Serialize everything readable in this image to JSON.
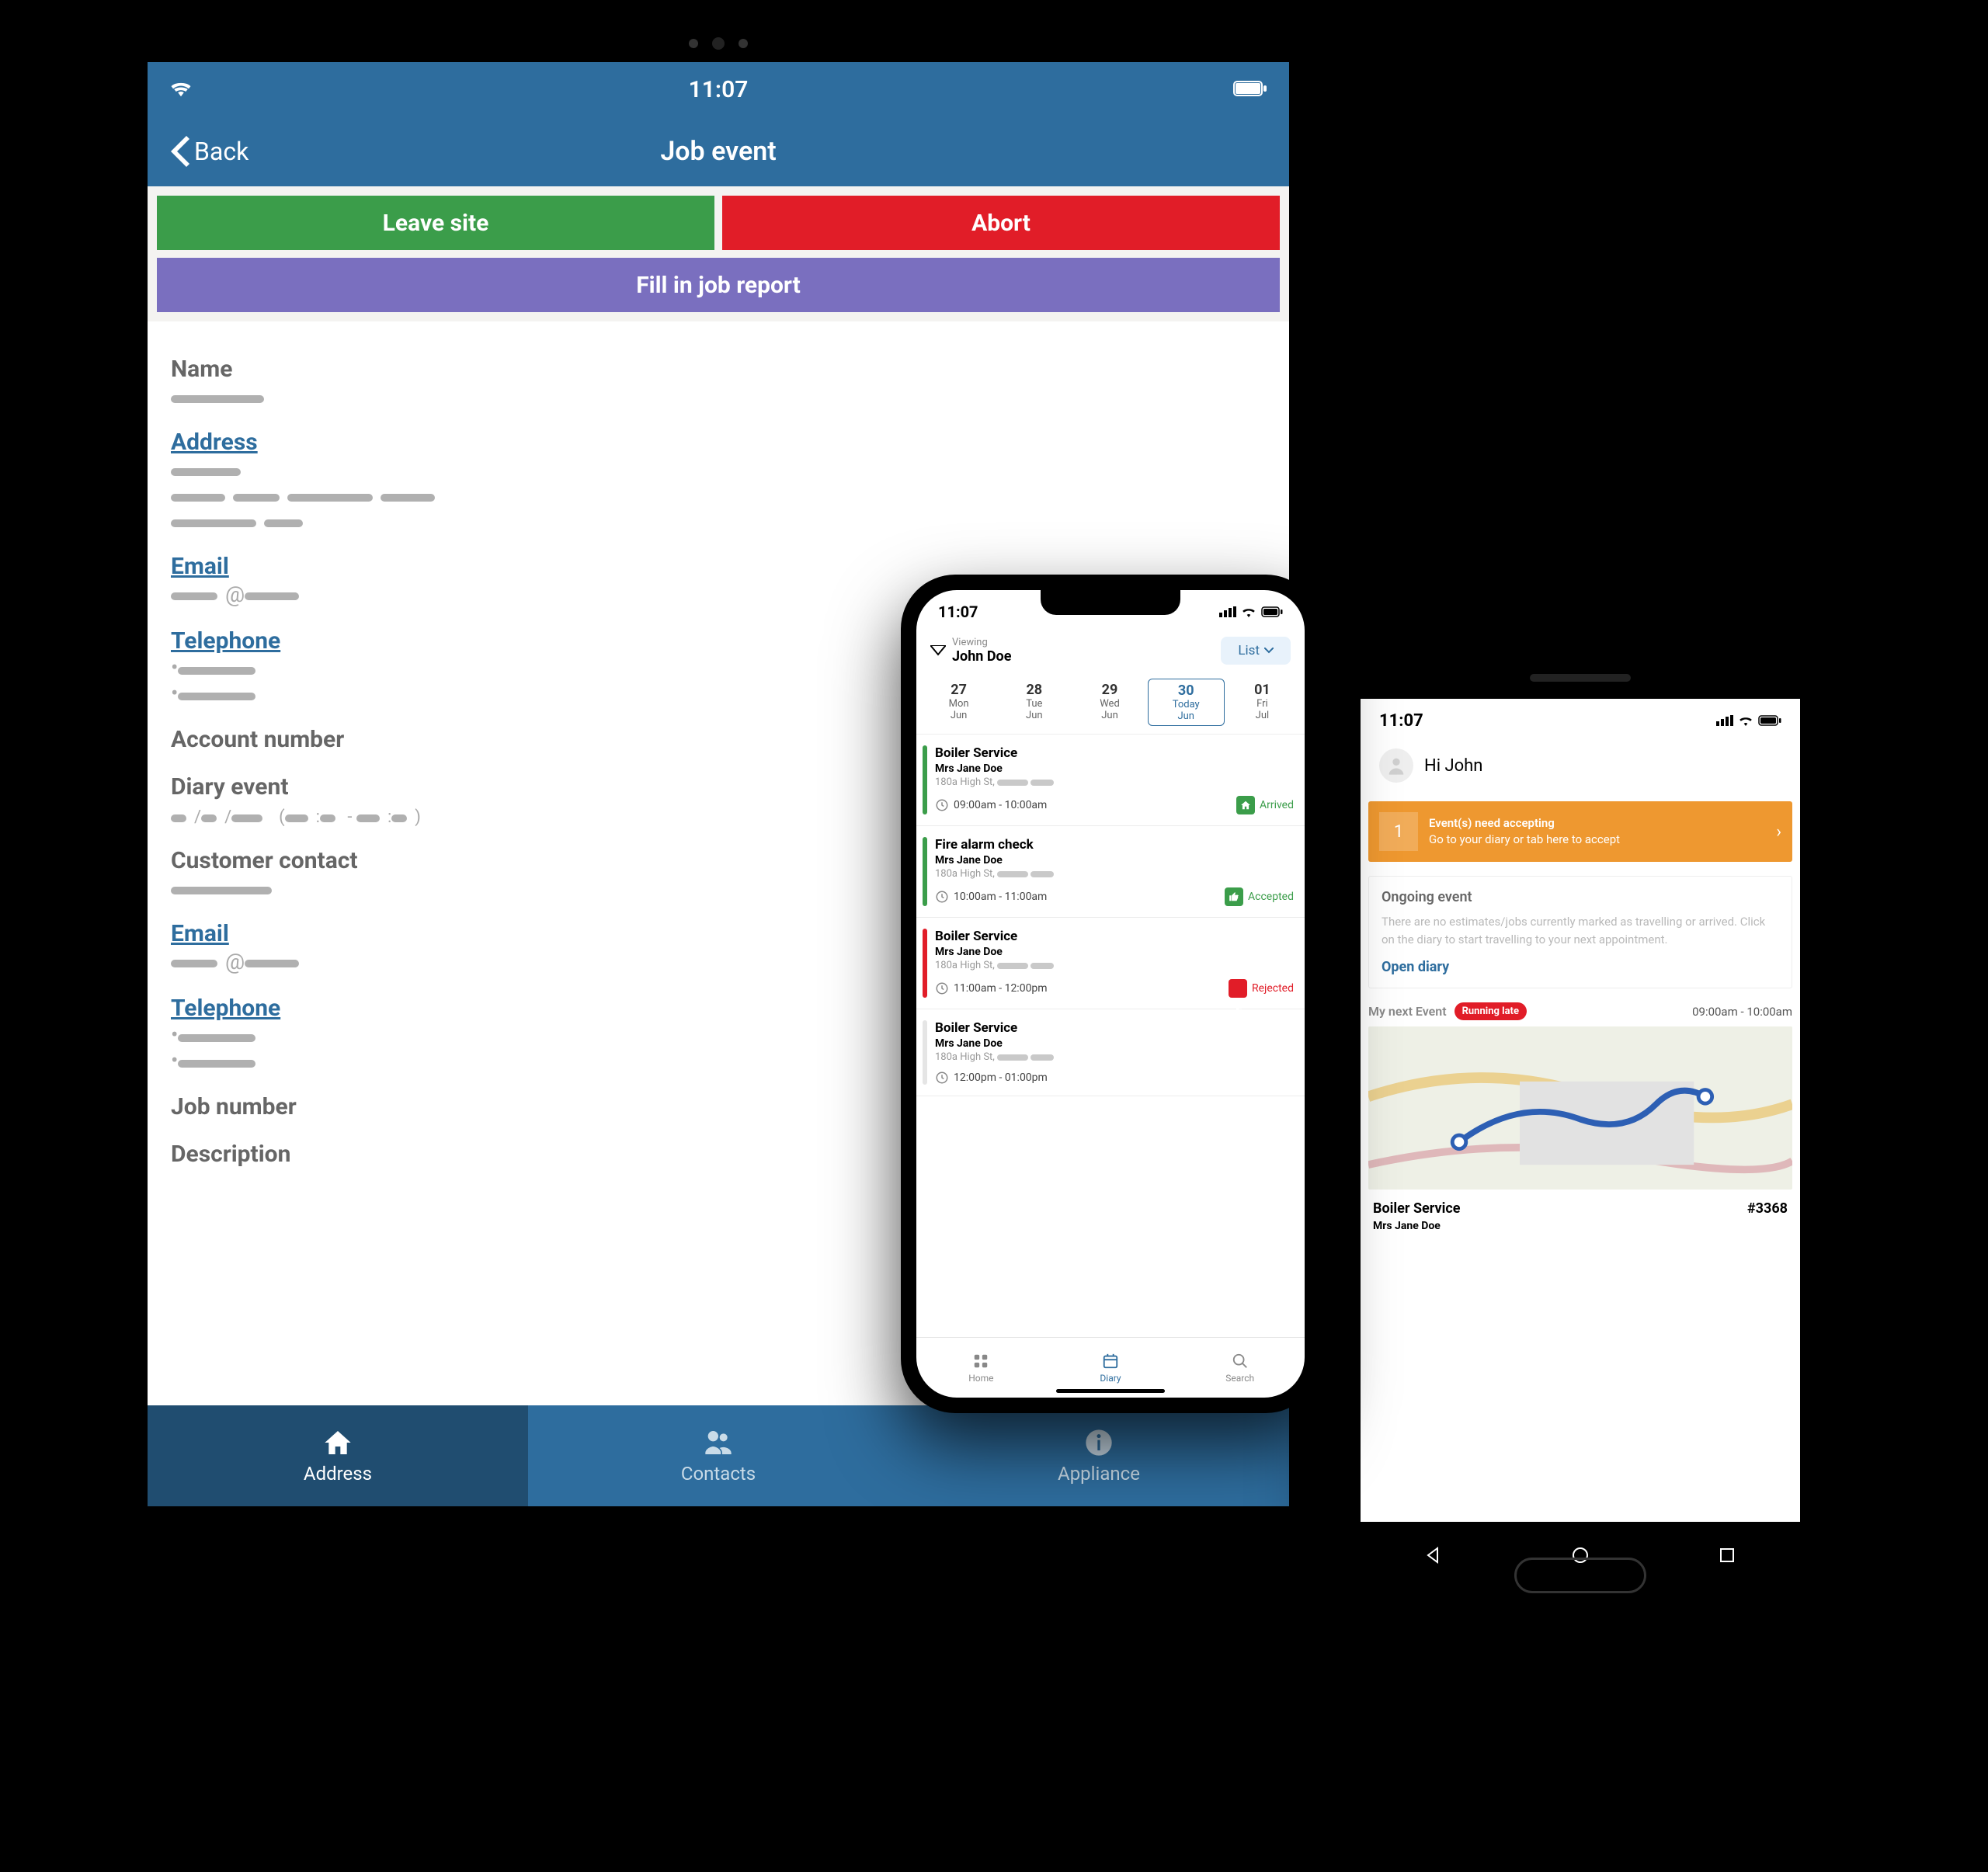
{
  "tablet": {
    "statusbar": {
      "time": "11:07"
    },
    "header": {
      "back": "Back",
      "title": "Job event"
    },
    "actions": {
      "leave": "Leave site",
      "abort": "Abort",
      "report": "Fill in job report"
    },
    "labels": {
      "name": "Name",
      "address": "Address",
      "email": "Email",
      "telephone": "Telephone",
      "account_number": "Account number",
      "diary_event": "Diary event",
      "customer_contact": "Customer contact",
      "job_number": "Job number",
      "description": "Description"
    },
    "tabs": {
      "address": "Address",
      "contacts": "Contacts",
      "appliance": "Appliance"
    }
  },
  "iphone": {
    "statusbar": {
      "time": "11:07"
    },
    "viewing": {
      "label": "Viewing",
      "name": "John Doe"
    },
    "toggle": "List",
    "dates": [
      {
        "num": "27",
        "dow": "Mon",
        "mon": "Jun",
        "today": false
      },
      {
        "num": "28",
        "dow": "Tue",
        "mon": "Jun",
        "today": false
      },
      {
        "num": "29",
        "dow": "Wed",
        "mon": "Jun",
        "today": false
      },
      {
        "num": "30",
        "dow": "Today",
        "mon": "Jun",
        "today": true
      },
      {
        "num": "01",
        "dow": "Fri",
        "mon": "Jul",
        "today": false
      }
    ],
    "events": [
      {
        "title": "Boiler Service",
        "customer": "Mrs Jane Doe",
        "addr": "180a High St,",
        "time": "09:00am - 10:00am",
        "status": "Arrived",
        "status_kind": "arrived",
        "stripe": "green"
      },
      {
        "title": "Fire alarm check",
        "customer": "Mrs Jane Doe",
        "addr": "180a High St,",
        "time": "10:00am - 11:00am",
        "status": "Accepted",
        "status_kind": "accepted",
        "stripe": "green"
      },
      {
        "title": "Boiler Service",
        "customer": "Mrs Jane Doe",
        "addr": "180a High St,",
        "time": "11:00am - 12:00pm",
        "status": "Rejected",
        "status_kind": "rejected",
        "stripe": "red"
      },
      {
        "title": "Boiler Service",
        "customer": "Mrs Jane Doe",
        "addr": "180a High St,",
        "time": "12:00pm - 01:00pm",
        "status": "",
        "status_kind": "",
        "stripe": "grey"
      }
    ],
    "tabs": {
      "home": "Home",
      "diary": "Diary",
      "search": "Search"
    }
  },
  "android": {
    "statusbar": {
      "time": "11:07"
    },
    "greeting": "Hi John",
    "banner": {
      "count": "1",
      "line1": "Event(s) need accepting",
      "line2": "Go to your diary or tab here to accept"
    },
    "ongoing": {
      "heading": "Ongoing event",
      "message": "There are no estimates/jobs currently marked as travelling or arrived. Click on the diary to start travelling to your next appointment."
    },
    "open_diary": "Open diary",
    "next_label": "My next Event",
    "running_late": "Running late",
    "next_time": "09:00am - 10:00am",
    "next_event": {
      "title": "Boiler Service",
      "ref": "#3368",
      "customer": "Mrs Jane Doe"
    }
  }
}
